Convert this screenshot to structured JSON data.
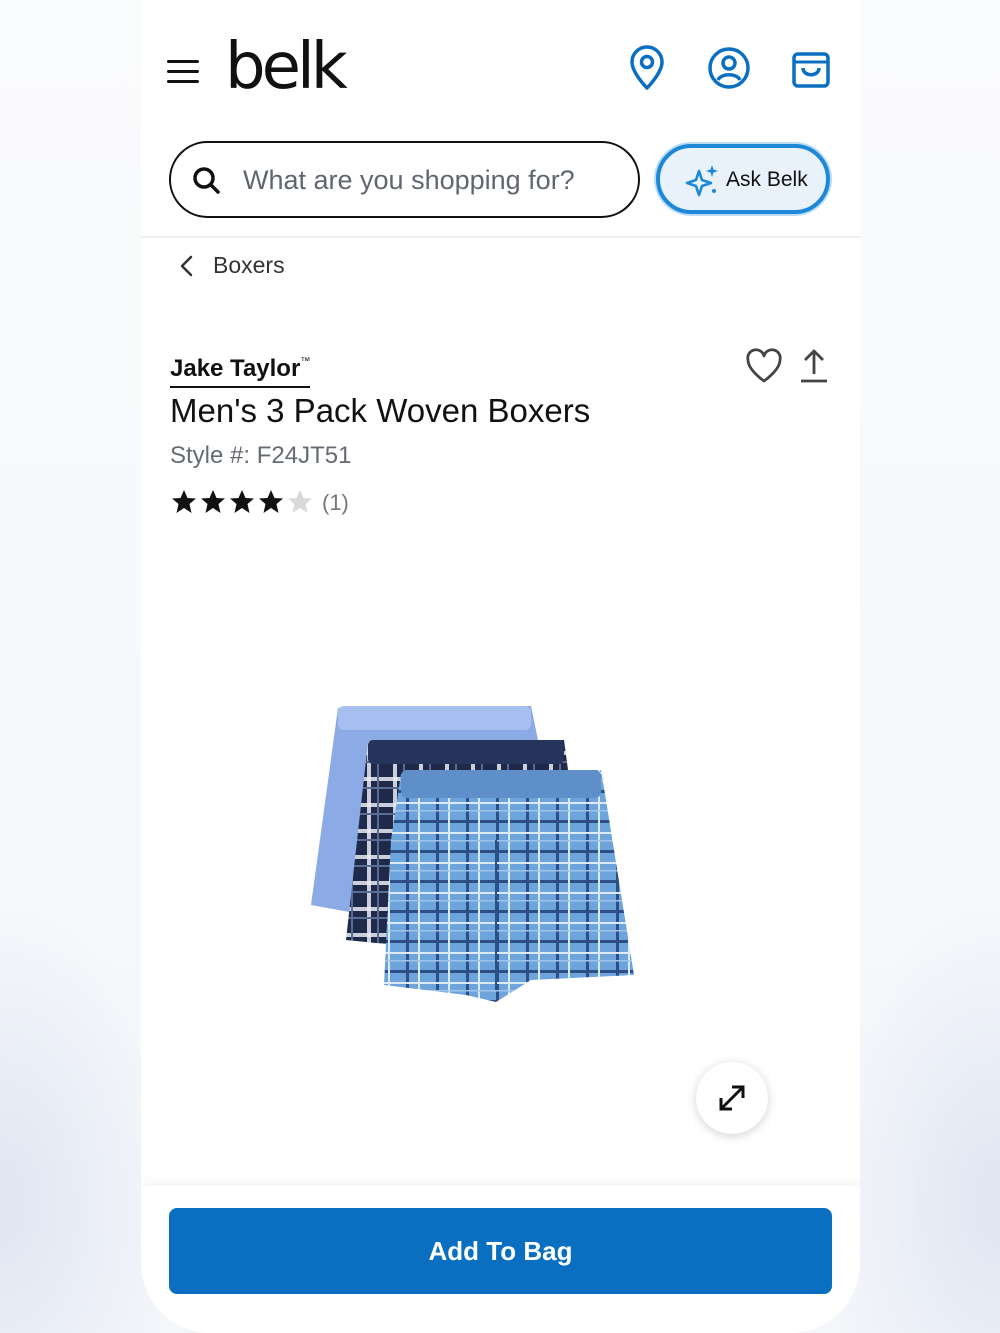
{
  "header": {
    "logo_text": "belk",
    "search_placeholder": "What are you shopping for?",
    "ask_label": "Ask Belk",
    "accent_color": "#1e88d8"
  },
  "breadcrumb": {
    "label": "Boxers"
  },
  "product": {
    "brand": "Jake Taylor",
    "brand_mark": "™",
    "title": "Men's 3 Pack Woven Boxers",
    "style": "Style #: F24JT51",
    "rating": 4,
    "rating_max": 5,
    "review_count": "(1)"
  },
  "actions": {
    "add_to_bag": "Add To Bag",
    "button_color": "#0a6fc0"
  }
}
